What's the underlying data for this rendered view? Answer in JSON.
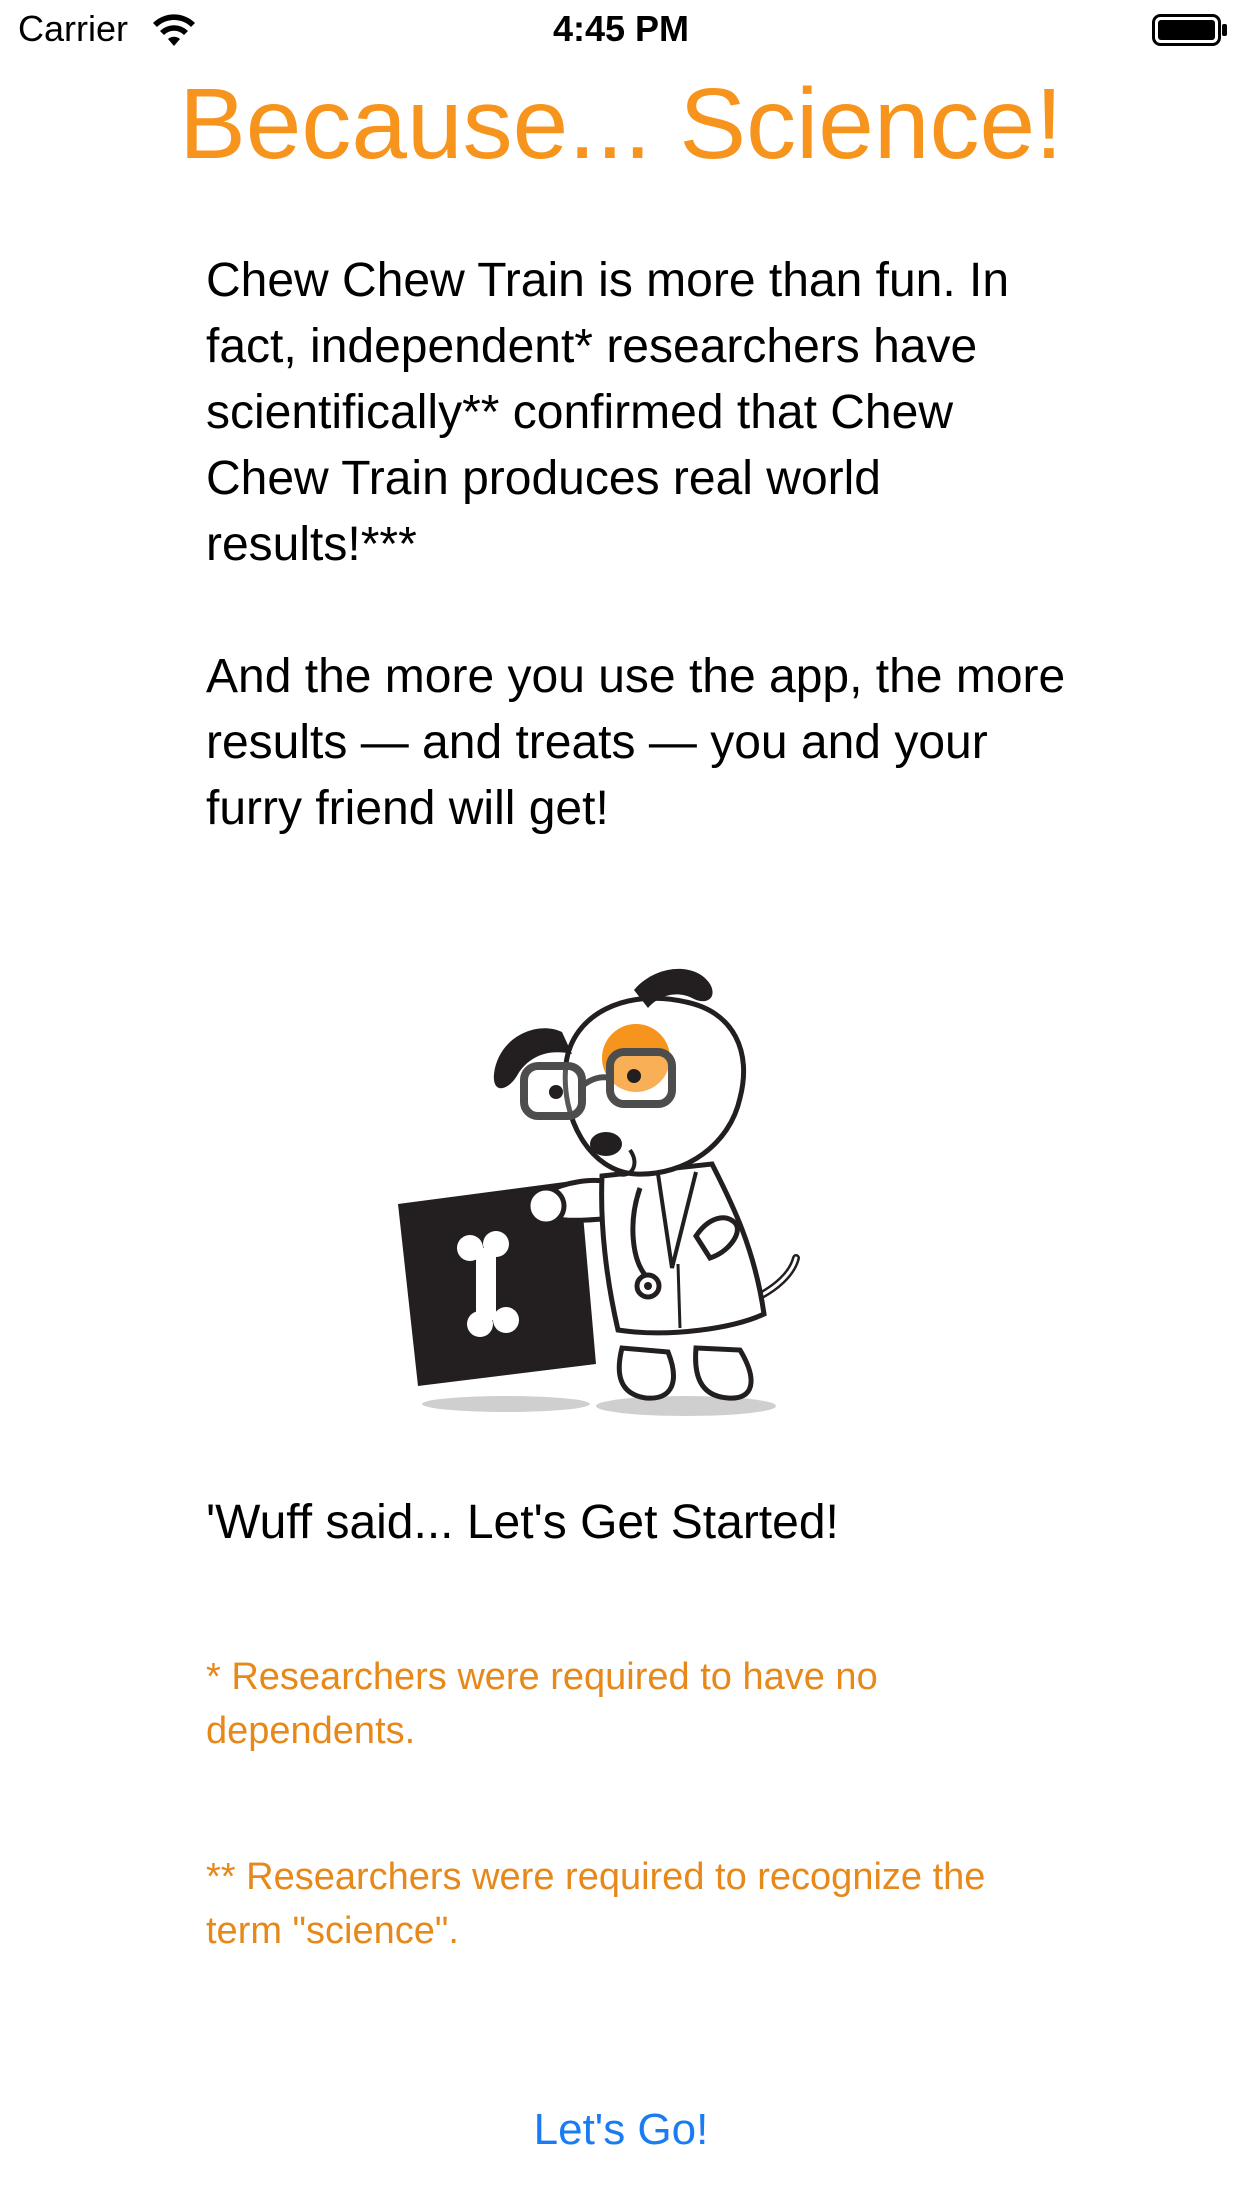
{
  "status_bar": {
    "carrier": "Carrier",
    "time": "4:45 PM",
    "wifi_icon": "wifi-icon",
    "battery_icon": "battery-icon"
  },
  "title": "Because... Science!",
  "paragraphs": [
    "Chew Chew Train is more than fun. In fact, independent* researchers have scientifically** confirmed that Chew Chew Train produces real world results!***",
    "And the more you use the app, the more results — and treats — you and your furry friend will get!"
  ],
  "illustration": {
    "icon": "scientist-dog-illustration"
  },
  "tagline": "'Wuff said... Let's Get Started!",
  "footnotes": [
    "* Researchers were required to have no dependents.",
    "** Researchers were required to recognize the term \"science\"."
  ],
  "actions": {
    "go_label": "Let's Go!"
  },
  "colors": {
    "title": "#f7941d",
    "footnote": "#e6891a",
    "link": "#1a7cf3"
  }
}
